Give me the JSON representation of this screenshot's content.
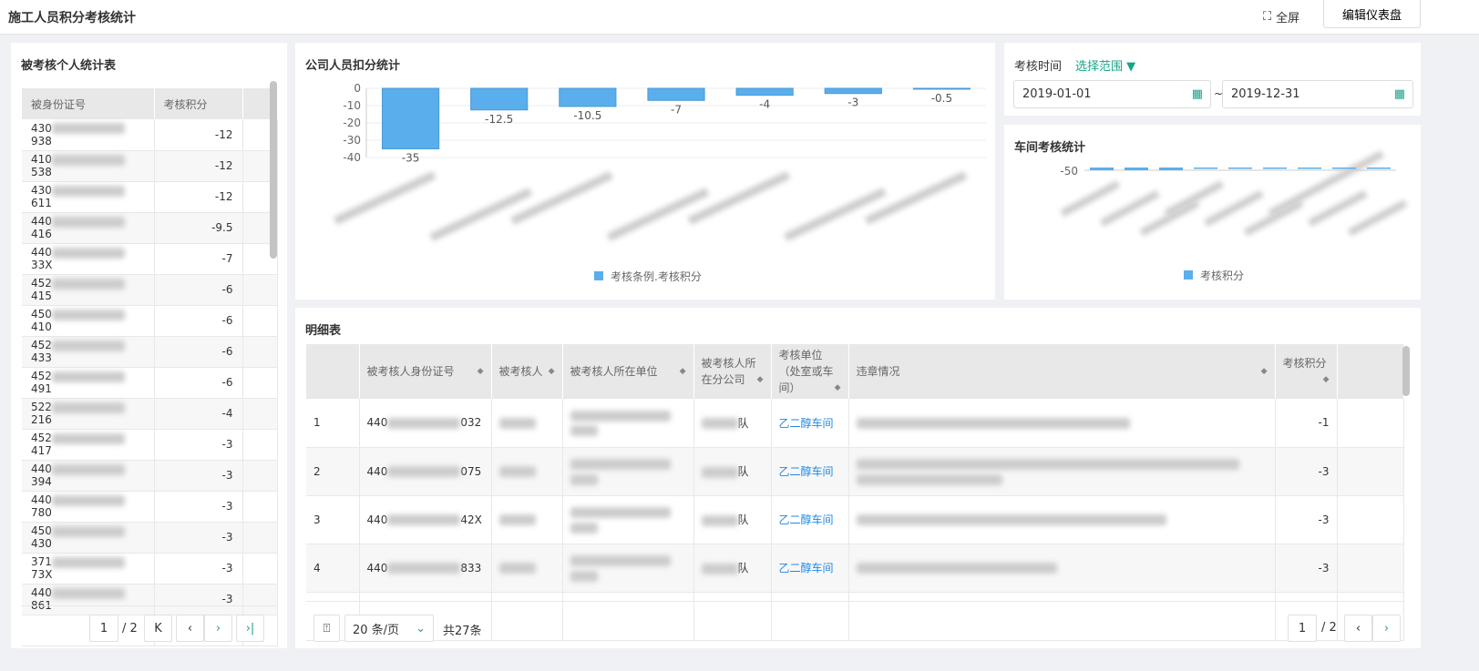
{
  "header": {
    "title": "施工人员积分考核统计",
    "fullscreen": "全屏",
    "edit": "编辑仪表盘"
  },
  "personal": {
    "title": "被考核个人统计表",
    "columns": [
      "被身份证号",
      "考核积分"
    ],
    "rows": [
      [
        "430",
        "938",
        "-12"
      ],
      [
        "410",
        "538",
        "-12"
      ],
      [
        "430",
        "611",
        "-12"
      ],
      [
        "440",
        "416",
        "-9.5"
      ],
      [
        "440",
        "33X",
        "-7"
      ],
      [
        "452",
        "415",
        "-6"
      ],
      [
        "450",
        "410",
        "-6"
      ],
      [
        "452",
        "433",
        "-6"
      ],
      [
        "452",
        "491",
        "-6"
      ],
      [
        "522",
        "216",
        "-4"
      ],
      [
        "452",
        "417",
        "-3"
      ],
      [
        "440",
        "394",
        "-3"
      ],
      [
        "440",
        "780",
        "-3"
      ],
      [
        "450",
        "430",
        "-3"
      ],
      [
        "371",
        "73X",
        "-3"
      ],
      [
        "440",
        "861",
        "-3"
      ]
    ],
    "page": "1",
    "total_pages": "/ 2"
  },
  "company_chart": {
    "title": "公司人员扣分统计",
    "legend": "考核条例.考核积分"
  },
  "workshop_chart": {
    "title": "车间考核统计",
    "legend": "考核积分",
    "tick": "-50"
  },
  "chart_data": [
    {
      "type": "bar",
      "title": "公司人员扣分统计",
      "values": [
        -35,
        -12.5,
        -10.5,
        -7,
        -4,
        -3,
        -0.5
      ],
      "ylim": [
        -40,
        0
      ],
      "yticks": [
        0,
        -10,
        -20,
        -30,
        -40
      ],
      "series": [
        {
          "name": "考核条例.考核积分"
        }
      ],
      "color": "#5aaeeb",
      "grid": true,
      "legend": "bottom"
    },
    {
      "type": "bar",
      "title": "车间考核统计",
      "yticks": [
        -50
      ],
      "series": [
        {
          "name": "考核积分"
        }
      ],
      "bar_count": 9,
      "color": "#5aaeeb",
      "legend": "bottom"
    }
  ],
  "filter": {
    "label": "考核时间",
    "range": "选择范围",
    "start": "2019-01-01",
    "end": "2019-12-31",
    "sep": "~"
  },
  "detail": {
    "title": "明细表",
    "columns": [
      "被考核人身份证号",
      "被考核人",
      "被考核人所在单位",
      "被考核人所在分公司",
      "考核单位（处室或车间）",
      "违章情况",
      "考核积分"
    ],
    "rows": [
      {
        "n": "1",
        "pre": "440",
        "suf": "032",
        "branch": "队",
        "unit": "乙二醇车间",
        "score": "-1"
      },
      {
        "n": "2",
        "pre": "440",
        "suf": "075",
        "branch": "队",
        "unit": "乙二醇车间",
        "score": "-3"
      },
      {
        "n": "3",
        "pre": "440",
        "suf": "42X",
        "branch": "队",
        "unit": "乙二醇车间",
        "score": "-3"
      },
      {
        "n": "4",
        "pre": "440",
        "suf": "833",
        "branch": "队",
        "unit": "乙二醇车间",
        "score": "-3"
      }
    ],
    "page_size": "20 条/页",
    "total": "共27条",
    "page": "1",
    "total_pages": "/ 2"
  },
  "colors": {
    "accent": "#17a589",
    "bar": "#5aaeeb",
    "link": "#1e88e5"
  }
}
